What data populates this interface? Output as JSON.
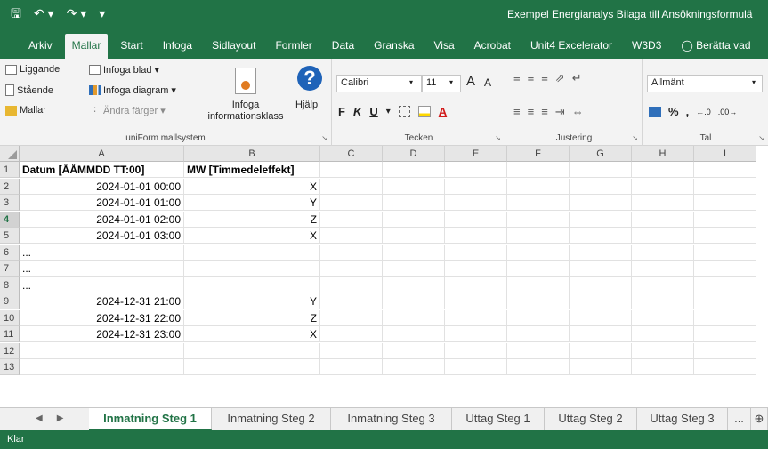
{
  "titlebar": {
    "save_icon": "save-icon",
    "undo_icon": "undo-icon",
    "redo_icon": "redo-icon",
    "title": "Exempel Energianalys Bilaga till Ansökningsformulä"
  },
  "ribbon_tabs": [
    {
      "label": "Arkiv"
    },
    {
      "label": "Mallar"
    },
    {
      "label": "Start"
    },
    {
      "label": "Infoga"
    },
    {
      "label": "Sidlayout"
    },
    {
      "label": "Formler"
    },
    {
      "label": "Data"
    },
    {
      "label": "Granska"
    },
    {
      "label": "Visa"
    },
    {
      "label": "Acrobat"
    },
    {
      "label": "Unit4 Excelerator"
    },
    {
      "label": "W3D3"
    },
    {
      "label": "Berätta vad"
    }
  ],
  "ribbon": {
    "uniform": {
      "liggande": "Liggande",
      "staende": "Stående",
      "mallar": "Mallar",
      "infoga_blad": "Infoga blad ▾",
      "infoga_diagram": "Infoga diagram ▾",
      "andra_farger": "Ändra färger ▾",
      "infoga_info_1": "Infoga",
      "infoga_info_2": "informationsklass",
      "hjalp": "Hjälp",
      "label": "uniForm mallsystem"
    },
    "tecken": {
      "font": "Calibri",
      "size": "11",
      "label": "Tecken",
      "bold": "F",
      "italic": "K",
      "underline": "U",
      "grow": "A",
      "shrink": "A"
    },
    "justering": {
      "label": "Justering"
    },
    "tal": {
      "format": "Allmänt",
      "label": "Tal",
      "percent": "%",
      "comma": ","
    }
  },
  "sheet": {
    "columns": [
      "A",
      "B",
      "C",
      "D",
      "E",
      "F",
      "G",
      "H",
      "I"
    ],
    "rows": [
      {
        "n": "1",
        "a": "Datum [ÅÅMMDD TT:00]",
        "b": "MW [Timmedeleffekt]"
      },
      {
        "n": "2",
        "a": "2024-01-01 00:00",
        "b": "X"
      },
      {
        "n": "3",
        "a": "2024-01-01 01:00",
        "b": "Y"
      },
      {
        "n": "4",
        "a": "2024-01-01 02:00",
        "b": "Z"
      },
      {
        "n": "5",
        "a": "2024-01-01 03:00",
        "b": "X"
      },
      {
        "n": "6",
        "a": "...",
        "b": ""
      },
      {
        "n": "7",
        "a": "...",
        "b": ""
      },
      {
        "n": "8",
        "a": "...",
        "b": ""
      },
      {
        "n": "9",
        "a": "2024-12-31 21:00",
        "b": "Y"
      },
      {
        "n": "10",
        "a": "2024-12-31 22:00",
        "b": "Z"
      },
      {
        "n": "11",
        "a": "2024-12-31 23:00",
        "b": "X"
      },
      {
        "n": "12",
        "a": "",
        "b": ""
      },
      {
        "n": "13",
        "a": "",
        "b": ""
      }
    ]
  },
  "sheet_tabs": [
    {
      "label": "Inmatning Steg 1"
    },
    {
      "label": "Inmatning Steg 2"
    },
    {
      "label": "Inmatning Steg 3"
    },
    {
      "label": "Uttag Steg 1"
    },
    {
      "label": "Uttag Steg 2"
    },
    {
      "label": "Uttag Steg 3"
    },
    {
      "label": "..."
    },
    {
      "label": "⊕"
    }
  ],
  "status": {
    "text": "Klar"
  },
  "colors": {
    "brand": "#217346"
  }
}
